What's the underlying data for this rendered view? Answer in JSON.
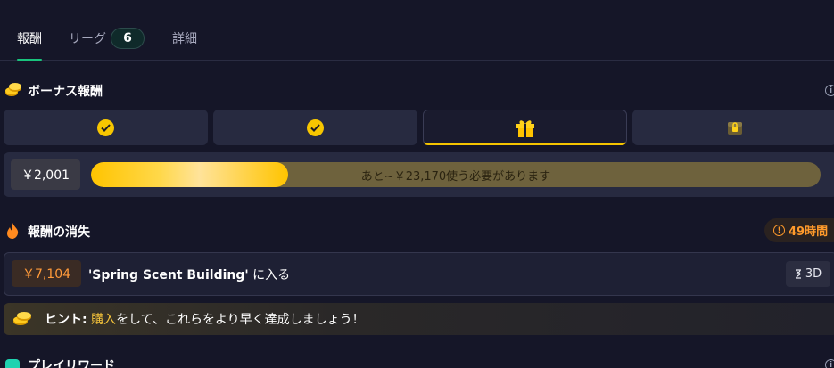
{
  "tabs": [
    {
      "label": "報酬"
    },
    {
      "label": "リーグ",
      "badge": "6"
    },
    {
      "label": "詳細"
    }
  ],
  "bonus": {
    "title": "ボーナス報酬",
    "tiers": [
      "check-icon",
      "check-icon",
      "gift-icon",
      "locked-chest-icon"
    ],
    "amount": "￥2,001",
    "progress_fraction": 0.27,
    "progress_text": "あと~￥23,170使う必要があります"
  },
  "expiring": {
    "title": "報酬の消失",
    "time_left": "49時間",
    "reward": {
      "amount": "￥7,104",
      "quoted": "'Spring Scent Building'",
      "suffix": " に入る",
      "duration": "3D"
    }
  },
  "hint": {
    "label": "ヒント:",
    "link": "購入",
    "rest": "をして、これらをより早く達成しましょう！"
  },
  "next_section": {
    "title": "プレイリワード"
  },
  "colors": {
    "accent_green": "#19c37d",
    "gold": "#f7c600",
    "orange": "#ff9a2b"
  }
}
